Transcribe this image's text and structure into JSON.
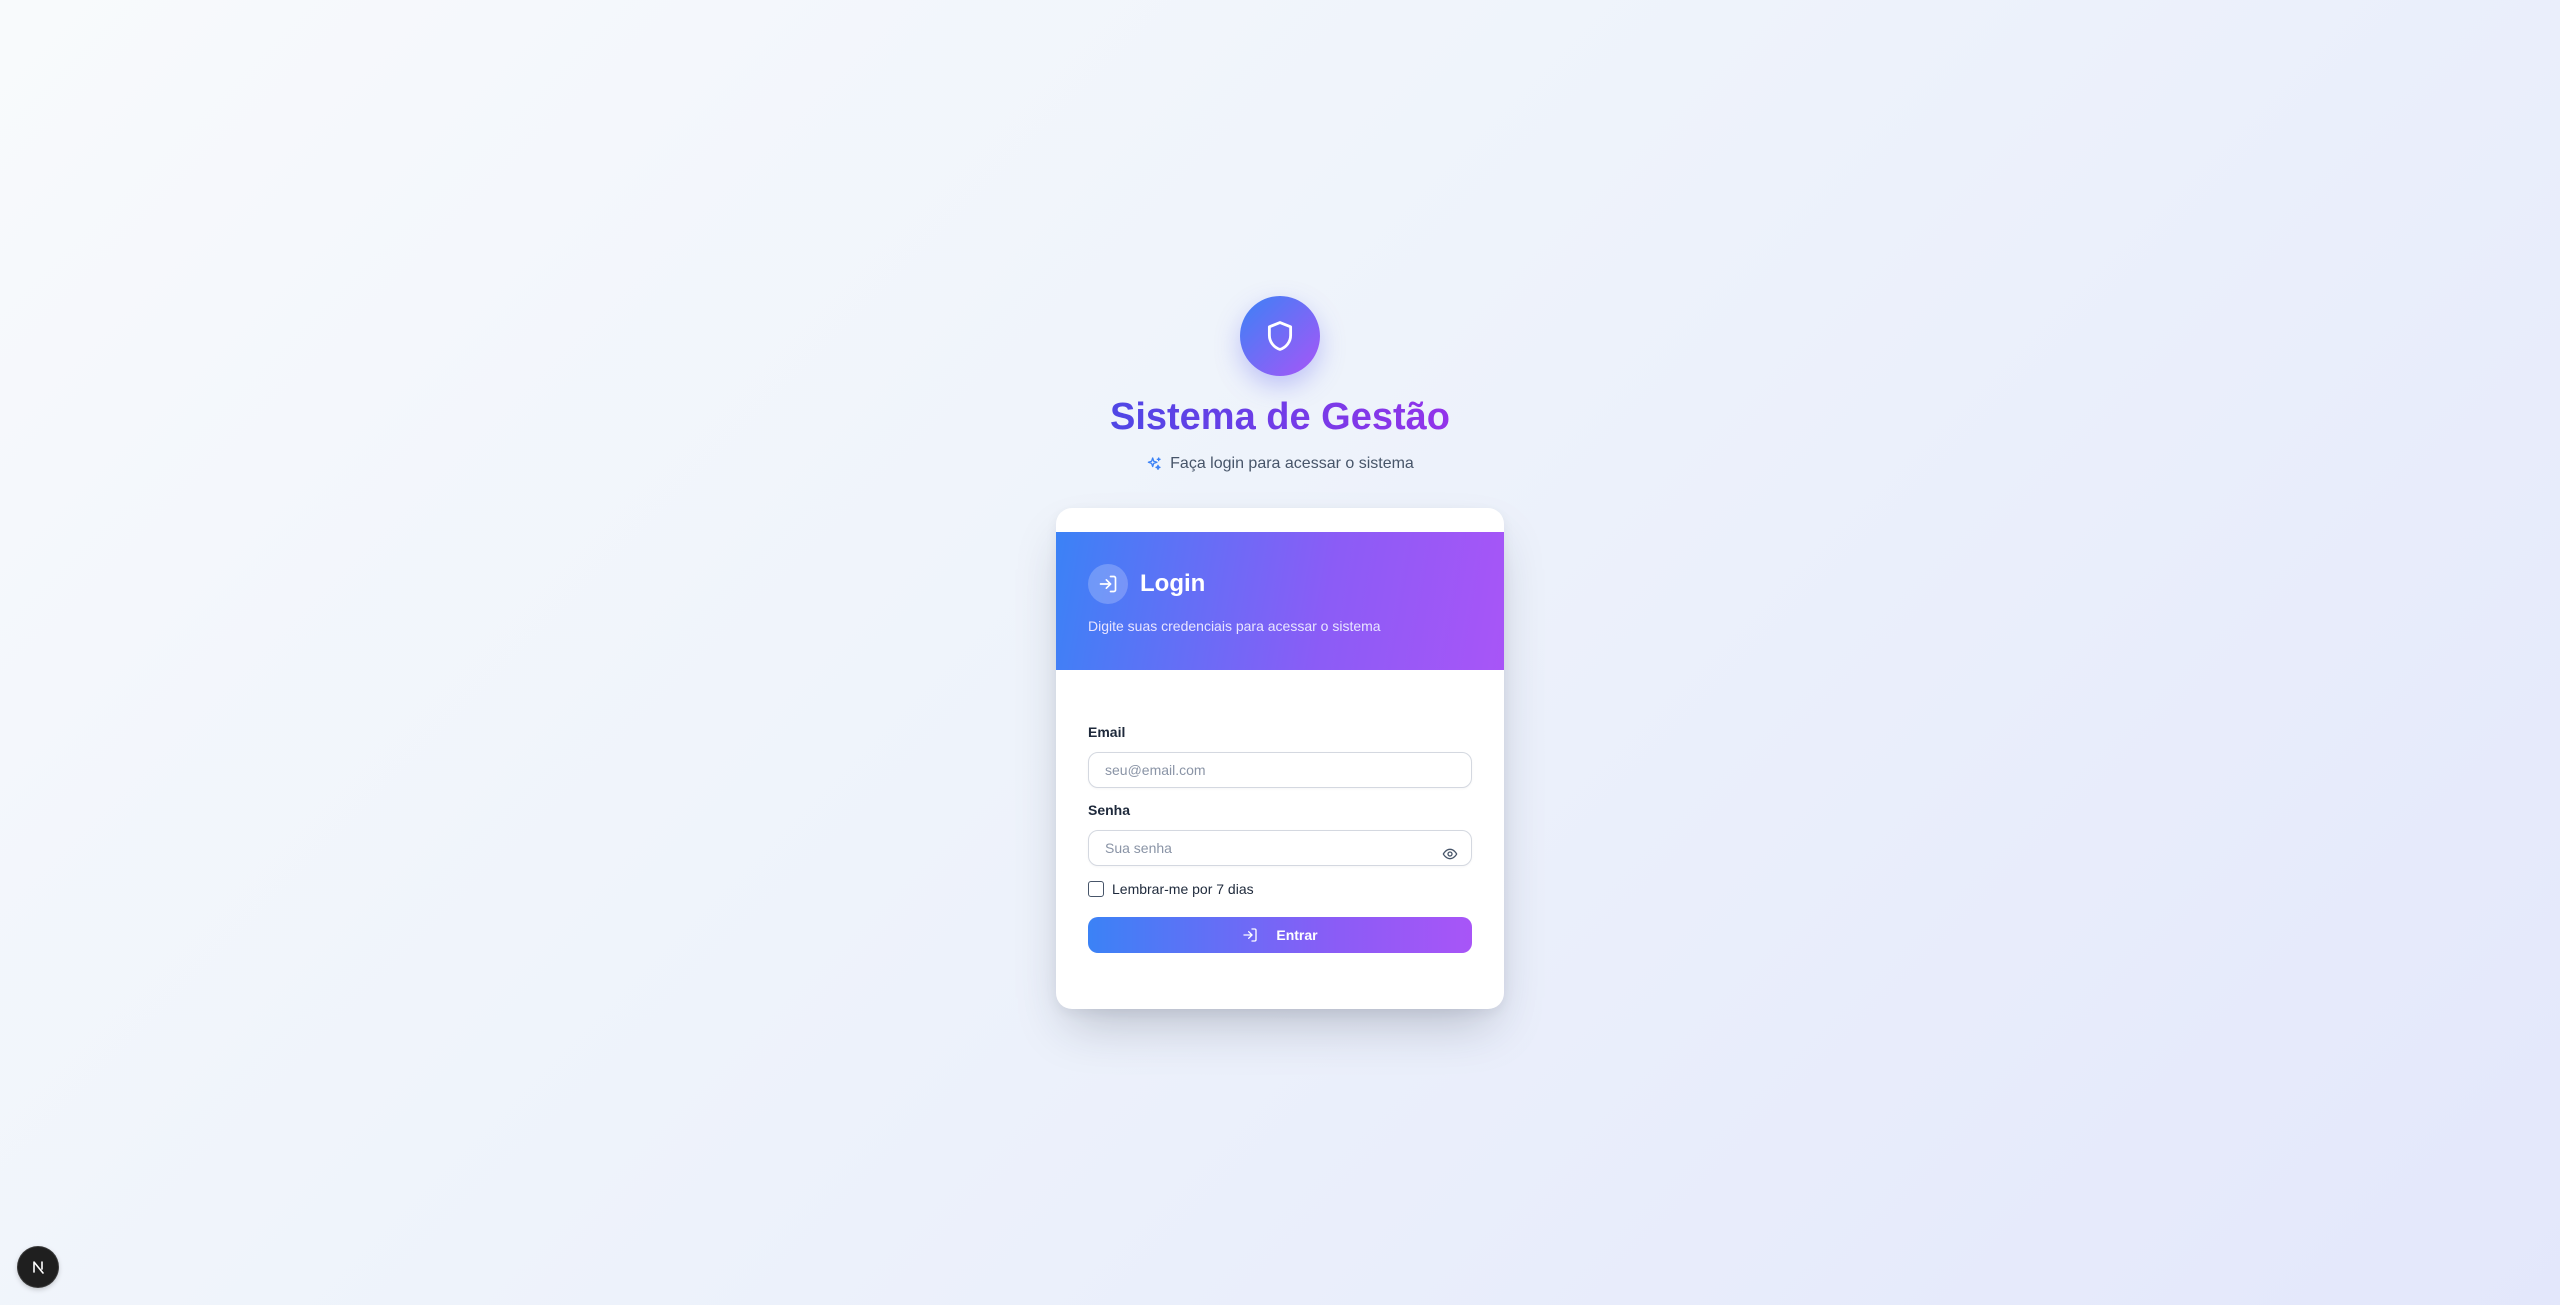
{
  "branding": {
    "logo_icon": "shield-icon",
    "title": "Sistema de Gestão",
    "subtitle_icon": "sparkles-icon",
    "subtitle": "Faça login para acessar o sistema"
  },
  "login_card": {
    "header_icon": "log-in-icon",
    "title": "Login",
    "description": "Digite suas credenciais para acessar o sistema",
    "email": {
      "label": "Email",
      "value": "",
      "placeholder": "seu@email.com"
    },
    "password": {
      "label": "Senha",
      "value": "",
      "placeholder": "Sua senha",
      "toggle_icon": "eye-icon"
    },
    "remember": {
      "label": "Lembrar-me por 7 dias",
      "checked": false
    },
    "submit": {
      "icon": "log-in-icon",
      "label": "Entrar"
    }
  },
  "dev_badge": {
    "icon": "nextjs-logo-icon"
  },
  "colors": {
    "gradient_start": "#3b82f6",
    "gradient_end": "#a855f7",
    "title_start": "#4f46e5",
    "title_end": "#9333ea"
  }
}
